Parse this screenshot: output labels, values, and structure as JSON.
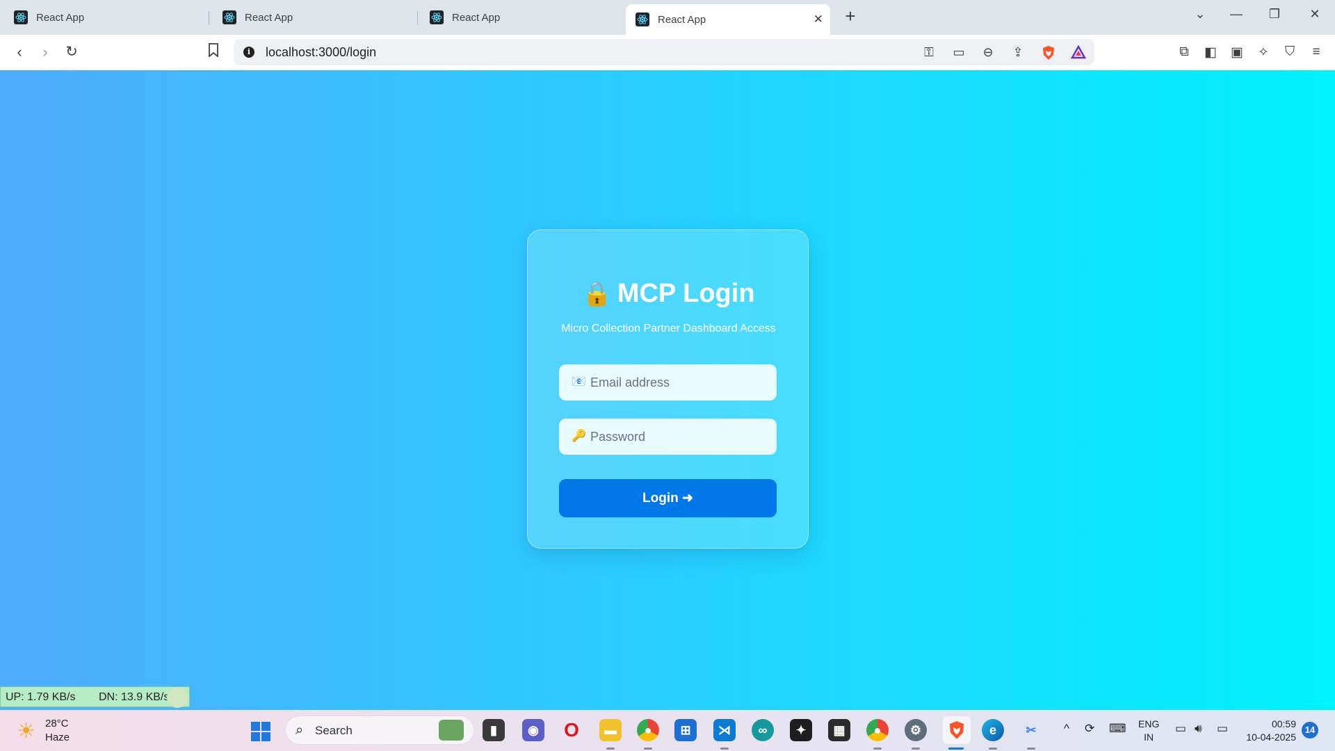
{
  "browser": {
    "tabs": [
      {
        "title": "React App"
      },
      {
        "title": "React App"
      },
      {
        "title": "React App"
      },
      {
        "title": "React App",
        "active": true
      }
    ],
    "tab_close_glyph": "✕",
    "new_tab_glyph": "+",
    "url": "localhost:3000/login"
  },
  "login": {
    "title": "MCP Login",
    "lock_emoji": "🔒",
    "subtitle": "Micro Collection Partner Dashboard Access",
    "email_icon": "📧",
    "email_placeholder": "Email address",
    "email_value": "",
    "password_icon": "🔑",
    "password_placeholder": "Password",
    "password_value": "",
    "button_label": "Login ➜",
    "gradient_start": "#4facfe",
    "gradient_end": "#00f2fe",
    "button_color": "#0077e6"
  },
  "netspeed": {
    "up": "UP: 1.79 KB/s",
    "down": "DN: 13.9 KB/s"
  },
  "taskbar": {
    "weather_temp": "28°C",
    "weather_desc": "Haze",
    "search_label": "Search",
    "lang_line1": "ENG",
    "lang_line2": "IN",
    "time": "00:59",
    "date": "10-04-2025",
    "notification_count": "14"
  }
}
